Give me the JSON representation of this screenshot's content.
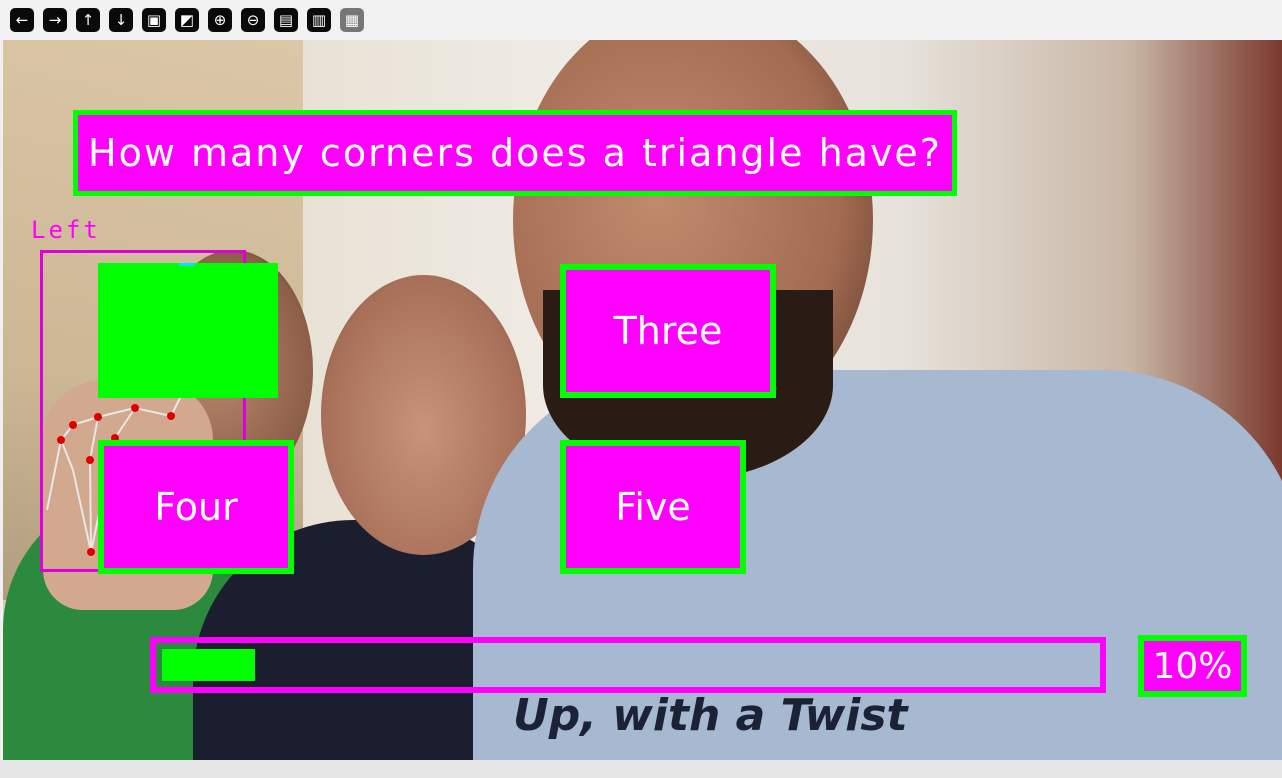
{
  "toolbar": {
    "buttons": [
      {
        "icon": "arrow-left-icon",
        "glyph": "←",
        "enabled": true
      },
      {
        "icon": "arrow-right-icon",
        "glyph": "→",
        "enabled": true
      },
      {
        "icon": "arrow-up-icon",
        "glyph": "↑",
        "enabled": true
      },
      {
        "icon": "arrow-down-icon",
        "glyph": "↓",
        "enabled": true
      },
      {
        "icon": "image-icon",
        "glyph": "▣",
        "enabled": true
      },
      {
        "icon": "image-settings-icon",
        "glyph": "◩",
        "enabled": true
      },
      {
        "icon": "zoom-in-icon",
        "glyph": "⊕",
        "enabled": true
      },
      {
        "icon": "zoom-out-icon",
        "glyph": "⊖",
        "enabled": true
      },
      {
        "icon": "save-icon",
        "glyph": "▤",
        "enabled": true
      },
      {
        "icon": "clipboard-icon",
        "glyph": "▥",
        "enabled": true
      },
      {
        "icon": "paint-brush-icon",
        "glyph": "▦",
        "enabled": false
      }
    ]
  },
  "quiz": {
    "question": "How many corners does a triangle have?",
    "answers": {
      "top_right": "Three",
      "bottom_left": "Four",
      "bottom_right": "Five"
    }
  },
  "hand_tracking": {
    "label": "Left"
  },
  "progress": {
    "value": 0.1,
    "label": "10%"
  },
  "scene": {
    "shirt_text": "Up, with a Twist"
  },
  "colors": {
    "box_fill": "#ff00ff",
    "box_border": "#00ff00",
    "text": "#ffffff",
    "landmark_point": "#e00000",
    "landmark_line": "#e8e8e8"
  }
}
